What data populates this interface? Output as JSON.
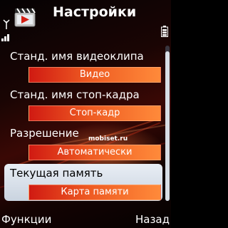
{
  "header": {
    "title": "Настройки",
    "app_icon": "video-clapper-icon"
  },
  "status": {
    "antenna_icon": "antenna-icon",
    "signal_icon": "signal-strength-icon",
    "battery_icon": "battery-icon"
  },
  "settings": [
    {
      "label": "Станд. имя видеоклипа",
      "value": "Видео"
    },
    {
      "label": "Станд. имя стоп-кадра",
      "value": "Стоп-кадр"
    },
    {
      "label": "Разрешение",
      "value": "Автоматически"
    },
    {
      "label": "Текущая память",
      "value": "Карта памяти"
    }
  ],
  "watermark": "mobiset.ru",
  "softkeys": {
    "left": "Функции",
    "right": "Назад"
  },
  "colors": {
    "value_box_start": "#d01a12",
    "value_box_end": "#ff8a3a",
    "highlight": "#d9e1eb"
  }
}
